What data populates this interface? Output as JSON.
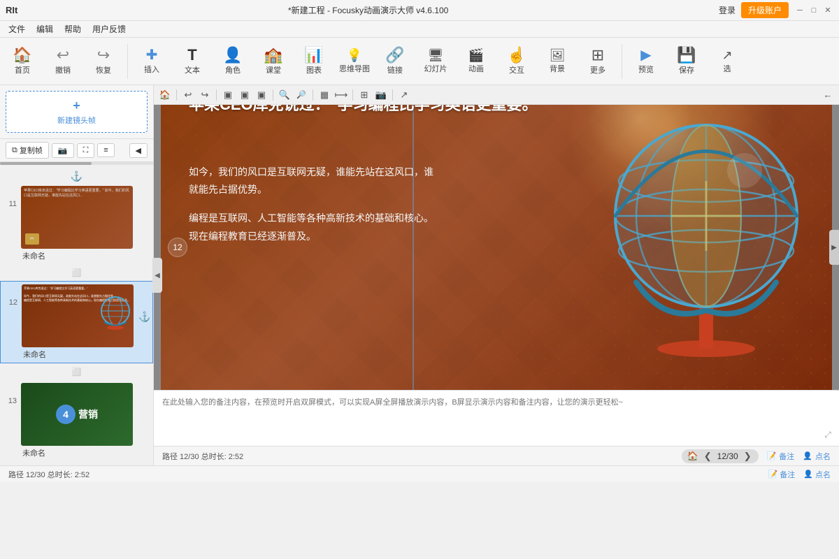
{
  "titlebar": {
    "app_name": "RIt",
    "title": "*新建工程 - Focusky动画演示大师 v4.6.100",
    "login": "登录",
    "upgrade": "升级账户",
    "min": "─",
    "max": "□",
    "close": "✕"
  },
  "menubar": {
    "items": [
      "文件",
      "编辑",
      "帮助",
      "用户反馈"
    ]
  },
  "toolbar": {
    "items": [
      {
        "id": "home",
        "icon": "🏠",
        "label": "首页"
      },
      {
        "id": "undo",
        "icon": "↩",
        "label": "撤销"
      },
      {
        "id": "redo",
        "icon": "↪",
        "label": "恢复"
      },
      {
        "id": "sep1",
        "type": "separator"
      },
      {
        "id": "insert",
        "icon": "✚",
        "label": "插入"
      },
      {
        "id": "text",
        "icon": "T",
        "label": "文本"
      },
      {
        "id": "role",
        "icon": "👤",
        "label": "角色"
      },
      {
        "id": "class",
        "icon": "🏫",
        "label": "课堂"
      },
      {
        "id": "chart",
        "icon": "📊",
        "label": "图表"
      },
      {
        "id": "mind",
        "icon": "💡",
        "label": "思维导图"
      },
      {
        "id": "link",
        "icon": "🔗",
        "label": "链接"
      },
      {
        "id": "slide",
        "icon": "🖥",
        "label": "幻灯片"
      },
      {
        "id": "anim",
        "icon": "🎬",
        "label": "动画"
      },
      {
        "id": "interact",
        "icon": "👆",
        "label": "交互"
      },
      {
        "id": "bg",
        "icon": "🖼",
        "label": "背景"
      },
      {
        "id": "more",
        "icon": "⊞",
        "label": "更多"
      },
      {
        "id": "sep2",
        "type": "separator"
      },
      {
        "id": "preview",
        "icon": "▶",
        "label": "预览"
      },
      {
        "id": "save",
        "icon": "💾",
        "label": "保存"
      },
      {
        "id": "select",
        "icon": "↗",
        "label": "选"
      }
    ]
  },
  "left_panel": {
    "new_frame": "新建镜头帧",
    "copy_frame": "复制帧",
    "camera_icon": "📷",
    "fullscreen_icon": "⛶",
    "more_icon": "≡",
    "slides": [
      {
        "number": "11",
        "name": "未命名",
        "active": false,
        "has_anchor": false,
        "content": "苹果CEO库克说过：学习编程比学习英语更重要。如今，我们的风口是互联网..."
      },
      {
        "number": "12",
        "name": "未命名",
        "active": true,
        "has_anchor": true
      },
      {
        "number": "13",
        "name": "未命名",
        "active": false,
        "has_anchor": false,
        "marketing_num": "4",
        "marketing_text": "营销"
      }
    ]
  },
  "slide": {
    "heading": "苹果CEO库克说过：“学习编程比学习英语更重要。”",
    "para1": "如今，我们的风口是互联网无疑，谁能先站在这风口，谁就能先占据优势。",
    "para2": "编程是互联网、人工智能等各种高新技术的基础和核心。现在编程教育已经逐渐普及。",
    "frame_number": "12"
  },
  "canvas_toolbar": {
    "tools": [
      "🏠",
      "⎌",
      "⎌",
      "▣",
      "▣",
      "▣",
      "🔍",
      "🔍",
      "▦",
      "⟼",
      "⊞",
      "📷",
      "↗",
      "←"
    ]
  },
  "notes": {
    "placeholder": "在此处输入您的备注内容，在预览时开启双屏模式，可以实现A屏全屏播放演示内容，B屏显示演示内容和备注内容，让您的演示更轻松~"
  },
  "nav": {
    "left_info": "路径 12/30  总时长: 2:52",
    "page_display": "12/30",
    "notes_label": "备注",
    "rollcall_label": "点名"
  },
  "status": {
    "path": "路径 12/30",
    "duration": "总时长: 2:52"
  },
  "colors": {
    "accent": "#4a90d9",
    "orange": "#ff8c00",
    "slide_bg": "#8b3a0a"
  }
}
